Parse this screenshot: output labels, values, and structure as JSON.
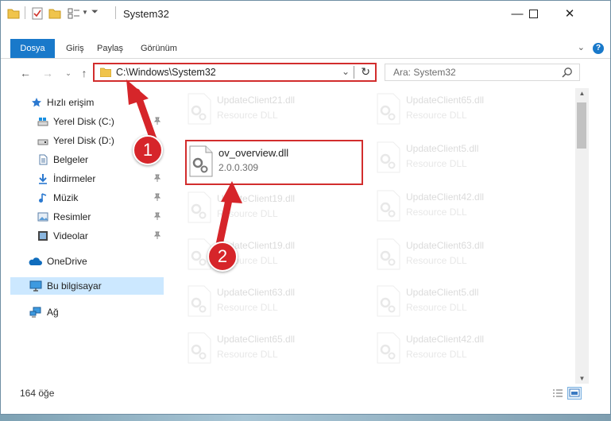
{
  "window": {
    "title": "System32",
    "controls": {
      "minimize": "—",
      "maximize": "☐",
      "close": "✕"
    }
  },
  "ribbon": {
    "tabs": [
      "Dosya",
      "Giriş",
      "Paylaş",
      "Görünüm"
    ],
    "help": "?"
  },
  "address": {
    "path": "C:\\Windows\\System32",
    "search_placeholder": "Ara: System32"
  },
  "nav": {
    "items": [
      {
        "label": "Hızlı erişim",
        "icon": "star-icon"
      },
      {
        "label": "Yerel Disk (C:)",
        "icon": "drive-icon",
        "pinned": true
      },
      {
        "label": "Yerel Disk (D:)",
        "icon": "drive-icon"
      },
      {
        "label": "Belgeler",
        "icon": "document-icon"
      },
      {
        "label": "İndirmeler",
        "icon": "download-icon",
        "pinned": true
      },
      {
        "label": "Müzik",
        "icon": "music-icon",
        "pinned": true
      },
      {
        "label": "Resimler",
        "icon": "pictures-icon",
        "pinned": true
      },
      {
        "label": "Videolar",
        "icon": "video-icon",
        "pinned": true
      },
      {
        "label": "OneDrive",
        "icon": "cloud-icon"
      },
      {
        "label": "Bu bilgisayar",
        "icon": "computer-icon",
        "selected": true
      },
      {
        "label": "Ağ",
        "icon": "network-icon"
      }
    ]
  },
  "files": {
    "left": [
      {
        "name": "UpdateClient21.dll",
        "desc": "Resource DLL"
      },
      {
        "name": "ov_overview.dll",
        "desc": "2.0.0.309",
        "highlighted": true
      },
      {
        "name": "UpdateClient19.dll",
        "desc": "Resource DLL"
      },
      {
        "name": "UpdateClient19.dll",
        "desc": "Resource DLL"
      },
      {
        "name": "UpdateClient63.dll",
        "desc": "Resource DLL"
      },
      {
        "name": "UpdateClient65.dll",
        "desc": "Resource DLL"
      }
    ],
    "right": [
      {
        "name": "UpdateClient65.dll",
        "desc": "Resource DLL"
      },
      {
        "name": "UpdateClient5.dll",
        "desc": "Resource DLL"
      },
      {
        "name": "UpdateClient42.dll",
        "desc": "Resource DLL"
      },
      {
        "name": "UpdateClient63.dll",
        "desc": "Resource DLL"
      },
      {
        "name": "UpdateClient5.dll",
        "desc": "Resource DLL"
      },
      {
        "name": "UpdateClient42.dll",
        "desc": "Resource DLL"
      }
    ]
  },
  "status": {
    "count": "164 öğe"
  },
  "annotations": {
    "step1": "1",
    "step2": "2",
    "color": "#d6252a"
  }
}
